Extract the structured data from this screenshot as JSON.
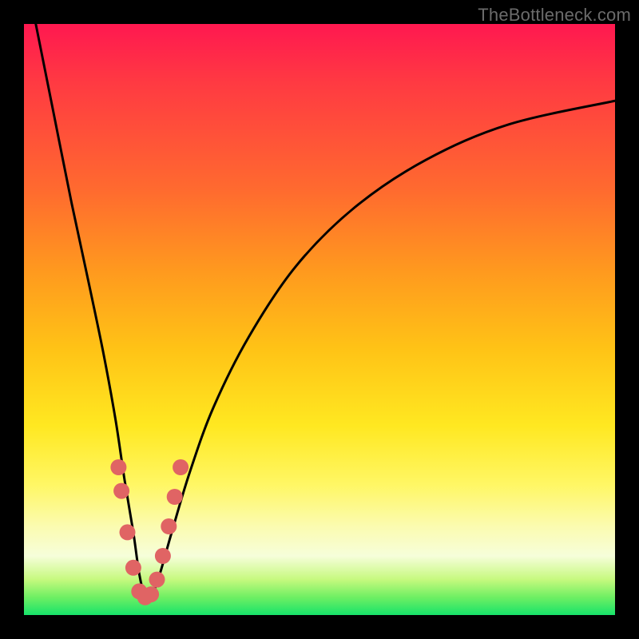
{
  "watermark": "TheBottleneck.com",
  "chart_data": {
    "type": "line",
    "title": "",
    "xlabel": "",
    "ylabel": "",
    "xlim": [
      0,
      100
    ],
    "ylim": [
      0,
      100
    ],
    "note": "Axes unlabeled in source image; x and y expressed as 0–100 percent of plot area. Curve is a V-shaped bottleneck curve with minimum near x≈20.",
    "series": [
      {
        "name": "bottleneck-curve",
        "x": [
          2,
          5,
          8,
          11,
          13.5,
          15.5,
          17,
          18.5,
          19.5,
          20.5,
          21.5,
          23,
          25,
          28,
          32,
          38,
          46,
          56,
          68,
          82,
          100
        ],
        "values": [
          100,
          85,
          70,
          56,
          44,
          33,
          23,
          14,
          7,
          3,
          3,
          7,
          14,
          24,
          35,
          47,
          59,
          69,
          77,
          83,
          87
        ]
      }
    ],
    "markers": {
      "name": "highlight-dots",
      "color": "#e06464",
      "radius_px": 10,
      "x": [
        16.0,
        16.5,
        17.5,
        18.5,
        19.5,
        20.5,
        21.5,
        22.5,
        23.5,
        24.5,
        25.5,
        26.5
      ],
      "values": [
        25.0,
        21.0,
        14.0,
        8.0,
        4.0,
        3.0,
        3.5,
        6.0,
        10.0,
        15.0,
        20.0,
        25.0
      ]
    }
  }
}
